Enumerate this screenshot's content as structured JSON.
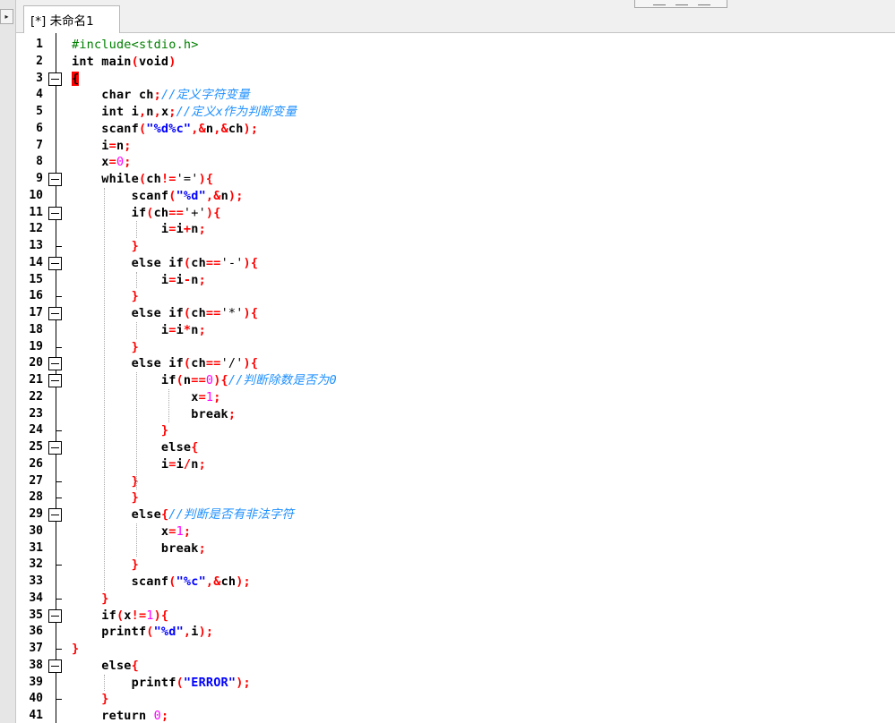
{
  "tab": {
    "label": "[*] 未命名1"
  },
  "sidebar": {
    "toggle": "▸"
  },
  "colors": {
    "keyword": "#000000",
    "punct": "#ff0000",
    "string": "#0000ff",
    "number": "#ff00ff",
    "comment": "#1e90ff",
    "preproc": "#008000"
  },
  "lines": [
    {
      "n": "1",
      "fold": "",
      "tokens": [
        {
          "t": "#include<stdio.h>",
          "c": "pp"
        }
      ]
    },
    {
      "n": "2",
      "fold": "",
      "tokens": [
        {
          "t": "int",
          "c": "kw"
        },
        {
          "t": " main",
          "c": "id"
        },
        {
          "t": "(",
          "c": "p"
        },
        {
          "t": "void",
          "c": "kw"
        },
        {
          "t": ")",
          "c": "p"
        }
      ]
    },
    {
      "n": "3",
      "fold": "open",
      "tokens": [
        {
          "t": "{",
          "c": "cur"
        }
      ]
    },
    {
      "n": "4",
      "fold": "",
      "tokens": [
        {
          "t": "    char",
          "c": "kw"
        },
        {
          "t": " ch",
          "c": "id"
        },
        {
          "t": ";",
          "c": "p"
        },
        {
          "t": "//定义字符变量",
          "c": "cm"
        }
      ]
    },
    {
      "n": "5",
      "fold": "",
      "tokens": [
        {
          "t": "    int",
          "c": "kw"
        },
        {
          "t": " i",
          "c": "id"
        },
        {
          "t": ",",
          "c": "p"
        },
        {
          "t": "n",
          "c": "id"
        },
        {
          "t": ",",
          "c": "p"
        },
        {
          "t": "x",
          "c": "id"
        },
        {
          "t": ";",
          "c": "p"
        },
        {
          "t": "//定义x作为判断变量",
          "c": "cm"
        }
      ]
    },
    {
      "n": "6",
      "fold": "",
      "tokens": [
        {
          "t": "    scanf",
          "c": "id"
        },
        {
          "t": "(",
          "c": "p"
        },
        {
          "t": "\"%d%c\"",
          "c": "str"
        },
        {
          "t": ",",
          "c": "p"
        },
        {
          "t": "&",
          "c": "p"
        },
        {
          "t": "n",
          "c": "id"
        },
        {
          "t": ",",
          "c": "p"
        },
        {
          "t": "&",
          "c": "p"
        },
        {
          "t": "ch",
          "c": "id"
        },
        {
          "t": ");",
          "c": "p"
        }
      ]
    },
    {
      "n": "7",
      "fold": "",
      "tokens": [
        {
          "t": "    i",
          "c": "id"
        },
        {
          "t": "=",
          "c": "p"
        },
        {
          "t": "n",
          "c": "id"
        },
        {
          "t": ";",
          "c": "p"
        }
      ]
    },
    {
      "n": "8",
      "fold": "",
      "tokens": [
        {
          "t": "    x",
          "c": "id"
        },
        {
          "t": "=",
          "c": "p"
        },
        {
          "t": "0",
          "c": "num"
        },
        {
          "t": ";",
          "c": "p"
        }
      ]
    },
    {
      "n": "9",
      "fold": "open",
      "tokens": [
        {
          "t": "    while",
          "c": "kw"
        },
        {
          "t": "(",
          "c": "p"
        },
        {
          "t": "ch",
          "c": "id"
        },
        {
          "t": "!=",
          "c": "p"
        },
        {
          "t": "'='",
          "c": "id"
        },
        {
          "t": "){",
          "c": "p"
        }
      ]
    },
    {
      "n": "10",
      "fold": "",
      "tokens": [
        {
          "t": "        scanf",
          "c": "id"
        },
        {
          "t": "(",
          "c": "p"
        },
        {
          "t": "\"%d\"",
          "c": "str"
        },
        {
          "t": ",",
          "c": "p"
        },
        {
          "t": "&",
          "c": "p"
        },
        {
          "t": "n",
          "c": "id"
        },
        {
          "t": ");",
          "c": "p"
        }
      ]
    },
    {
      "n": "11",
      "fold": "open",
      "tokens": [
        {
          "t": "        if",
          "c": "kw"
        },
        {
          "t": "(",
          "c": "p"
        },
        {
          "t": "ch",
          "c": "id"
        },
        {
          "t": "==",
          "c": "p"
        },
        {
          "t": "'+'",
          "c": "id"
        },
        {
          "t": "){",
          "c": "p"
        }
      ]
    },
    {
      "n": "12",
      "fold": "",
      "tokens": [
        {
          "t": "            i",
          "c": "id"
        },
        {
          "t": "=",
          "c": "p"
        },
        {
          "t": "i",
          "c": "id"
        },
        {
          "t": "+",
          "c": "p"
        },
        {
          "t": "n",
          "c": "id"
        },
        {
          "t": ";",
          "c": "p"
        }
      ]
    },
    {
      "n": "13",
      "fold": "end",
      "tokens": [
        {
          "t": "        }",
          "c": "p"
        }
      ]
    },
    {
      "n": "14",
      "fold": "open",
      "tokens": [
        {
          "t": "        else",
          "c": "kw"
        },
        {
          "t": " if",
          "c": "kw"
        },
        {
          "t": "(",
          "c": "p"
        },
        {
          "t": "ch",
          "c": "id"
        },
        {
          "t": "==",
          "c": "p"
        },
        {
          "t": "'-'",
          "c": "id"
        },
        {
          "t": "){",
          "c": "p"
        }
      ]
    },
    {
      "n": "15",
      "fold": "",
      "tokens": [
        {
          "t": "            i",
          "c": "id"
        },
        {
          "t": "=",
          "c": "p"
        },
        {
          "t": "i",
          "c": "id"
        },
        {
          "t": "-",
          "c": "p"
        },
        {
          "t": "n",
          "c": "id"
        },
        {
          "t": ";",
          "c": "p"
        }
      ]
    },
    {
      "n": "16",
      "fold": "end",
      "tokens": [
        {
          "t": "        }",
          "c": "p"
        }
      ]
    },
    {
      "n": "17",
      "fold": "open",
      "tokens": [
        {
          "t": "        else",
          "c": "kw"
        },
        {
          "t": " if",
          "c": "kw"
        },
        {
          "t": "(",
          "c": "p"
        },
        {
          "t": "ch",
          "c": "id"
        },
        {
          "t": "==",
          "c": "p"
        },
        {
          "t": "'*'",
          "c": "id"
        },
        {
          "t": "){",
          "c": "p"
        }
      ]
    },
    {
      "n": "18",
      "fold": "",
      "tokens": [
        {
          "t": "            i",
          "c": "id"
        },
        {
          "t": "=",
          "c": "p"
        },
        {
          "t": "i",
          "c": "id"
        },
        {
          "t": "*",
          "c": "p"
        },
        {
          "t": "n",
          "c": "id"
        },
        {
          "t": ";",
          "c": "p"
        }
      ]
    },
    {
      "n": "19",
      "fold": "end",
      "tokens": [
        {
          "t": "        }",
          "c": "p"
        }
      ]
    },
    {
      "n": "20",
      "fold": "open",
      "tokens": [
        {
          "t": "        else",
          "c": "kw"
        },
        {
          "t": " if",
          "c": "kw"
        },
        {
          "t": "(",
          "c": "p"
        },
        {
          "t": "ch",
          "c": "id"
        },
        {
          "t": "==",
          "c": "p"
        },
        {
          "t": "'/'",
          "c": "id"
        },
        {
          "t": "){",
          "c": "p"
        }
      ]
    },
    {
      "n": "21",
      "fold": "open",
      "tokens": [
        {
          "t": "            if",
          "c": "kw"
        },
        {
          "t": "(",
          "c": "p"
        },
        {
          "t": "n",
          "c": "id"
        },
        {
          "t": "==",
          "c": "p"
        },
        {
          "t": "0",
          "c": "num"
        },
        {
          "t": "){",
          "c": "p"
        },
        {
          "t": "//判断除数是否为0",
          "c": "cm"
        }
      ]
    },
    {
      "n": "22",
      "fold": "",
      "tokens": [
        {
          "t": "                x",
          "c": "id"
        },
        {
          "t": "=",
          "c": "p"
        },
        {
          "t": "1",
          "c": "num"
        },
        {
          "t": ";",
          "c": "p"
        }
      ]
    },
    {
      "n": "23",
      "fold": "",
      "tokens": [
        {
          "t": "                break",
          "c": "kw"
        },
        {
          "t": ";",
          "c": "p"
        }
      ]
    },
    {
      "n": "24",
      "fold": "end",
      "tokens": [
        {
          "t": "            }",
          "c": "p"
        }
      ]
    },
    {
      "n": "25",
      "fold": "open",
      "tokens": [
        {
          "t": "            else",
          "c": "kw"
        },
        {
          "t": "{",
          "c": "p"
        }
      ]
    },
    {
      "n": "26",
      "fold": "",
      "tokens": [
        {
          "t": "            i",
          "c": "id"
        },
        {
          "t": "=",
          "c": "p"
        },
        {
          "t": "i",
          "c": "id"
        },
        {
          "t": "/",
          "c": "p"
        },
        {
          "t": "n",
          "c": "id"
        },
        {
          "t": ";",
          "c": "p"
        }
      ]
    },
    {
      "n": "27",
      "fold": "end",
      "tokens": [
        {
          "t": "        }",
          "c": "p"
        }
      ]
    },
    {
      "n": "28",
      "fold": "end",
      "tokens": [
        {
          "t": "        }",
          "c": "p"
        }
      ]
    },
    {
      "n": "29",
      "fold": "open",
      "tokens": [
        {
          "t": "        else",
          "c": "kw"
        },
        {
          "t": "{",
          "c": "p"
        },
        {
          "t": "//判断是否有非法字符",
          "c": "cm"
        }
      ]
    },
    {
      "n": "30",
      "fold": "",
      "tokens": [
        {
          "t": "            x",
          "c": "id"
        },
        {
          "t": "=",
          "c": "p"
        },
        {
          "t": "1",
          "c": "num"
        },
        {
          "t": ";",
          "c": "p"
        }
      ]
    },
    {
      "n": "31",
      "fold": "",
      "tokens": [
        {
          "t": "            break",
          "c": "kw"
        },
        {
          "t": ";",
          "c": "p"
        }
      ]
    },
    {
      "n": "32",
      "fold": "end",
      "tokens": [
        {
          "t": "        }",
          "c": "p"
        }
      ]
    },
    {
      "n": "33",
      "fold": "",
      "tokens": [
        {
          "t": "        scanf",
          "c": "id"
        },
        {
          "t": "(",
          "c": "p"
        },
        {
          "t": "\"%c\"",
          "c": "str"
        },
        {
          "t": ",",
          "c": "p"
        },
        {
          "t": "&",
          "c": "p"
        },
        {
          "t": "ch",
          "c": "id"
        },
        {
          "t": ");",
          "c": "p"
        }
      ]
    },
    {
      "n": "34",
      "fold": "end",
      "tokens": [
        {
          "t": "    }",
          "c": "p"
        }
      ]
    },
    {
      "n": "35",
      "fold": "open",
      "tokens": [
        {
          "t": "    if",
          "c": "kw"
        },
        {
          "t": "(",
          "c": "p"
        },
        {
          "t": "x",
          "c": "id"
        },
        {
          "t": "!=",
          "c": "p"
        },
        {
          "t": "1",
          "c": "num"
        },
        {
          "t": "){",
          "c": "p"
        }
      ]
    },
    {
      "n": "36",
      "fold": "",
      "tokens": [
        {
          "t": "    printf",
          "c": "id"
        },
        {
          "t": "(",
          "c": "p"
        },
        {
          "t": "\"%d\"",
          "c": "str"
        },
        {
          "t": ",",
          "c": "p"
        },
        {
          "t": "i",
          "c": "id"
        },
        {
          "t": ");",
          "c": "p"
        }
      ]
    },
    {
      "n": "37",
      "fold": "end",
      "tokens": [
        {
          "t": "}",
          "c": "p"
        }
      ]
    },
    {
      "n": "38",
      "fold": "open",
      "tokens": [
        {
          "t": "    else",
          "c": "kw"
        },
        {
          "t": "{",
          "c": "p"
        }
      ]
    },
    {
      "n": "39",
      "fold": "",
      "tokens": [
        {
          "t": "        printf",
          "c": "id"
        },
        {
          "t": "(",
          "c": "p"
        },
        {
          "t": "\"ERROR\"",
          "c": "str"
        },
        {
          "t": ");",
          "c": "p"
        }
      ]
    },
    {
      "n": "40",
      "fold": "end",
      "tokens": [
        {
          "t": "    }",
          "c": "p"
        }
      ]
    },
    {
      "n": "41",
      "fold": "",
      "tokens": [
        {
          "t": "    return",
          "c": "kw"
        },
        {
          "t": " ",
          "c": "id"
        },
        {
          "t": "0",
          "c": "num"
        },
        {
          "t": ";",
          "c": "p"
        }
      ]
    }
  ]
}
